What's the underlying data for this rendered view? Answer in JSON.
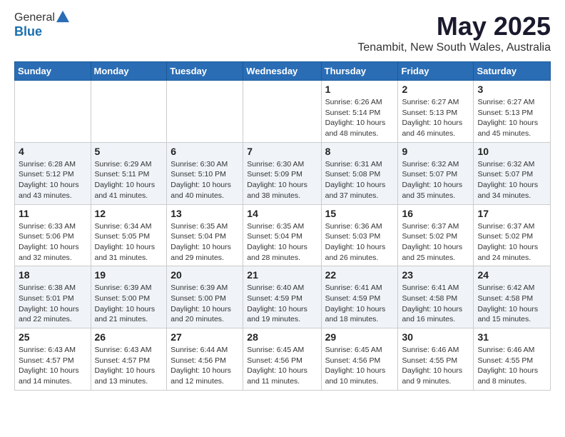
{
  "header": {
    "logo_line1": "General",
    "logo_line2": "Blue",
    "month_title": "May 2025",
    "location": "Tenambit, New South Wales, Australia"
  },
  "days_of_week": [
    "Sunday",
    "Monday",
    "Tuesday",
    "Wednesday",
    "Thursday",
    "Friday",
    "Saturday"
  ],
  "weeks": [
    [
      {
        "day": "",
        "info": ""
      },
      {
        "day": "",
        "info": ""
      },
      {
        "day": "",
        "info": ""
      },
      {
        "day": "",
        "info": ""
      },
      {
        "day": "1",
        "info": "Sunrise: 6:26 AM\nSunset: 5:14 PM\nDaylight: 10 hours\nand 48 minutes."
      },
      {
        "day": "2",
        "info": "Sunrise: 6:27 AM\nSunset: 5:13 PM\nDaylight: 10 hours\nand 46 minutes."
      },
      {
        "day": "3",
        "info": "Sunrise: 6:27 AM\nSunset: 5:13 PM\nDaylight: 10 hours\nand 45 minutes."
      }
    ],
    [
      {
        "day": "4",
        "info": "Sunrise: 6:28 AM\nSunset: 5:12 PM\nDaylight: 10 hours\nand 43 minutes."
      },
      {
        "day": "5",
        "info": "Sunrise: 6:29 AM\nSunset: 5:11 PM\nDaylight: 10 hours\nand 41 minutes."
      },
      {
        "day": "6",
        "info": "Sunrise: 6:30 AM\nSunset: 5:10 PM\nDaylight: 10 hours\nand 40 minutes."
      },
      {
        "day": "7",
        "info": "Sunrise: 6:30 AM\nSunset: 5:09 PM\nDaylight: 10 hours\nand 38 minutes."
      },
      {
        "day": "8",
        "info": "Sunrise: 6:31 AM\nSunset: 5:08 PM\nDaylight: 10 hours\nand 37 minutes."
      },
      {
        "day": "9",
        "info": "Sunrise: 6:32 AM\nSunset: 5:07 PM\nDaylight: 10 hours\nand 35 minutes."
      },
      {
        "day": "10",
        "info": "Sunrise: 6:32 AM\nSunset: 5:07 PM\nDaylight: 10 hours\nand 34 minutes."
      }
    ],
    [
      {
        "day": "11",
        "info": "Sunrise: 6:33 AM\nSunset: 5:06 PM\nDaylight: 10 hours\nand 32 minutes."
      },
      {
        "day": "12",
        "info": "Sunrise: 6:34 AM\nSunset: 5:05 PM\nDaylight: 10 hours\nand 31 minutes."
      },
      {
        "day": "13",
        "info": "Sunrise: 6:35 AM\nSunset: 5:04 PM\nDaylight: 10 hours\nand 29 minutes."
      },
      {
        "day": "14",
        "info": "Sunrise: 6:35 AM\nSunset: 5:04 PM\nDaylight: 10 hours\nand 28 minutes."
      },
      {
        "day": "15",
        "info": "Sunrise: 6:36 AM\nSunset: 5:03 PM\nDaylight: 10 hours\nand 26 minutes."
      },
      {
        "day": "16",
        "info": "Sunrise: 6:37 AM\nSunset: 5:02 PM\nDaylight: 10 hours\nand 25 minutes."
      },
      {
        "day": "17",
        "info": "Sunrise: 6:37 AM\nSunset: 5:02 PM\nDaylight: 10 hours\nand 24 minutes."
      }
    ],
    [
      {
        "day": "18",
        "info": "Sunrise: 6:38 AM\nSunset: 5:01 PM\nDaylight: 10 hours\nand 22 minutes."
      },
      {
        "day": "19",
        "info": "Sunrise: 6:39 AM\nSunset: 5:00 PM\nDaylight: 10 hours\nand 21 minutes."
      },
      {
        "day": "20",
        "info": "Sunrise: 6:39 AM\nSunset: 5:00 PM\nDaylight: 10 hours\nand 20 minutes."
      },
      {
        "day": "21",
        "info": "Sunrise: 6:40 AM\nSunset: 4:59 PM\nDaylight: 10 hours\nand 19 minutes."
      },
      {
        "day": "22",
        "info": "Sunrise: 6:41 AM\nSunset: 4:59 PM\nDaylight: 10 hours\nand 18 minutes."
      },
      {
        "day": "23",
        "info": "Sunrise: 6:41 AM\nSunset: 4:58 PM\nDaylight: 10 hours\nand 16 minutes."
      },
      {
        "day": "24",
        "info": "Sunrise: 6:42 AM\nSunset: 4:58 PM\nDaylight: 10 hours\nand 15 minutes."
      }
    ],
    [
      {
        "day": "25",
        "info": "Sunrise: 6:43 AM\nSunset: 4:57 PM\nDaylight: 10 hours\nand 14 minutes."
      },
      {
        "day": "26",
        "info": "Sunrise: 6:43 AM\nSunset: 4:57 PM\nDaylight: 10 hours\nand 13 minutes."
      },
      {
        "day": "27",
        "info": "Sunrise: 6:44 AM\nSunset: 4:56 PM\nDaylight: 10 hours\nand 12 minutes."
      },
      {
        "day": "28",
        "info": "Sunrise: 6:45 AM\nSunset: 4:56 PM\nDaylight: 10 hours\nand 11 minutes."
      },
      {
        "day": "29",
        "info": "Sunrise: 6:45 AM\nSunset: 4:56 PM\nDaylight: 10 hours\nand 10 minutes."
      },
      {
        "day": "30",
        "info": "Sunrise: 6:46 AM\nSunset: 4:55 PM\nDaylight: 10 hours\nand 9 minutes."
      },
      {
        "day": "31",
        "info": "Sunrise: 6:46 AM\nSunset: 4:55 PM\nDaylight: 10 hours\nand 8 minutes."
      }
    ]
  ]
}
